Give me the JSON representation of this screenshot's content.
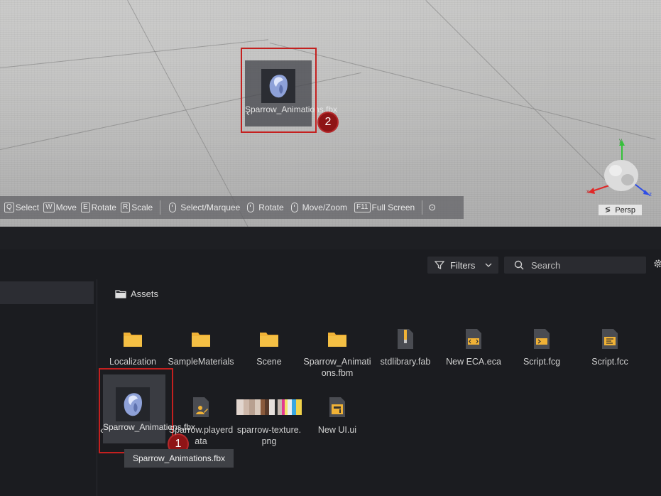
{
  "viewport": {
    "drag_preview": {
      "label": "Sparrow_Animations.fbx"
    },
    "markers": [
      "1",
      "2"
    ],
    "shortcuts": [
      {
        "key": "Q",
        "label": "Select"
      },
      {
        "key": "W",
        "label": "Move"
      },
      {
        "key": "E",
        "label": "Rotate"
      },
      {
        "key": "R",
        "label": "Scale"
      }
    ],
    "mouse_hints": [
      {
        "label": "Select/Marquee"
      },
      {
        "label": "Rotate"
      },
      {
        "label": "Move/Zoom"
      }
    ],
    "fullscreen": {
      "key": "F11",
      "label": "Full Screen"
    },
    "gizmo": {
      "x": "x",
      "y": "y",
      "z": "z"
    },
    "camera_mode": "Persp",
    "colors": {
      "highlight": "#c4201f",
      "marker": "#8e1416"
    }
  },
  "assets_panel": {
    "filters_label": "Filters",
    "search_placeholder": "Search",
    "breadcrumb": "Assets",
    "items": [
      {
        "name": "Localization",
        "icon": "folder-icon"
      },
      {
        "name": "SampleMaterials",
        "icon": "folder-icon"
      },
      {
        "name": "Scene",
        "icon": "folder-icon"
      },
      {
        "name": "Sparrow_Animations.fbm",
        "icon": "folder-icon"
      },
      {
        "name": "stdlibrary.fab",
        "icon": "zip-file-icon"
      },
      {
        "name": "New ECA.eca",
        "icon": "code-file-icon"
      },
      {
        "name": "Script.fcg",
        "icon": "script-file-icon"
      },
      {
        "name": "Script.fcc",
        "icon": "text-file-icon"
      },
      {
        "name": "Sparrow_Animations.fbx",
        "icon": "model-icon"
      },
      {
        "name": "Sparrow.playerdata",
        "icon": "playerdata-file-icon"
      },
      {
        "name": "sparrow-texture.png",
        "icon": "texture-thumbnail"
      },
      {
        "name": "New UI.ui",
        "icon": "ui-file-icon"
      }
    ],
    "tooltip": "Sparrow_Animations.fbx"
  }
}
